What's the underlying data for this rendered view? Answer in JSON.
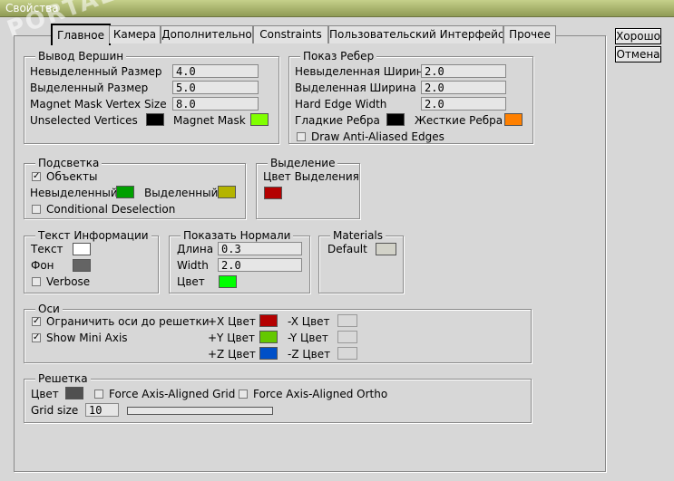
{
  "window": {
    "title": "Свойства"
  },
  "buttons": {
    "ok": "Хорошо",
    "cancel": "Отмена"
  },
  "tabs": [
    {
      "label": "Главное",
      "active": true
    },
    {
      "label": "Камера"
    },
    {
      "label": "Дополнительно"
    },
    {
      "label": "Constraints"
    },
    {
      "label": "Пользовательский Интерфейс"
    },
    {
      "label": "Прочее"
    }
  ],
  "vertex_output": {
    "title": "Вывод Вершин",
    "unselected_size_label": "Невыделенный Размер",
    "unselected_size": "4.0",
    "selected_size_label": "Выделенный Размер",
    "selected_size": "5.0",
    "magnet_mask_size_label": "Magnet Mask Vertex Size",
    "magnet_mask_size": "8.0",
    "unselected_vertices_label": "Unselected Vertices",
    "unselected_vertices_color": "#000000",
    "magnet_mask_label": "Magnet Mask",
    "magnet_mask_color": "#80ff00"
  },
  "edge_display": {
    "title": "Показ Ребер",
    "unselected_width_label": "Невыделенная Ширина",
    "unselected_width": "2.0",
    "selected_width_label": "Выделенная Ширина",
    "selected_width": "2.0",
    "hard_edge_width_label": "Hard Edge Width",
    "hard_edge_width": "2.0",
    "smooth_edges_label": "Гладкие Ребра",
    "smooth_edges_color": "#000000",
    "hard_edges_label": "Жесткие Ребра",
    "hard_edges_color": "#ff8000",
    "antialias_label": "Draw Anti-Aliased Edges",
    "antialias_checked": false
  },
  "highlight": {
    "title": "Подсветка",
    "objects_label": "Объекты",
    "objects_checked": true,
    "unselected_label": "Невыделенный",
    "unselected_color": "#00a000",
    "selected_label": "Выделенный",
    "selected_color": "#b4b400",
    "conditional_label": "Conditional Deselection",
    "conditional_checked": false
  },
  "selection": {
    "title": "Выделение",
    "color_label": "Цвет Выделения",
    "color": "#b40000"
  },
  "info_text": {
    "title": "Текст Информации",
    "text_label": "Текст",
    "text_color": "#ffffff",
    "bg_label": "Фон",
    "bg_color": "#646464",
    "verbose_label": "Verbose",
    "verbose_checked": false
  },
  "normals": {
    "title": "Показать Нормали",
    "length_label": "Длина",
    "length": "0.3",
    "width_label": "Width",
    "width": "2.0",
    "color_label": "Цвет",
    "color": "#00ff00"
  },
  "materials": {
    "title": "Materials",
    "default_label": "Default",
    "default_color": "#d2d2c8"
  },
  "axes": {
    "title": "Оси",
    "limit_label": "Ограничить оси до решетки",
    "limit_checked": true,
    "mini_label": "Show Mini Axis",
    "mini_checked": true,
    "px_label": "+X Цвет",
    "px_color": "#b40000",
    "py_label": "+Y Цвет",
    "py_color": "#64c800",
    "pz_label": "+Z Цвет",
    "pz_color": "#0050c8",
    "nx_label": "-X Цвет",
    "nx_color": "#d8d8d8",
    "ny_label": "-Y Цвет",
    "ny_color": "#d8d8d8",
    "nz_label": "-Z Цвет",
    "nz_color": "#d8d8d8"
  },
  "grid": {
    "title": "Решетка",
    "color_label": "Цвет",
    "color": "#505050",
    "force_grid_label": "Force Axis-Aligned Grid",
    "force_grid_checked": false,
    "force_ortho_label": "Force Axis-Aligned Ortho",
    "force_ortho_checked": false,
    "size_label": "Grid size",
    "size": "10",
    "slider_value": 0.0
  },
  "watermark": "PORTAL"
}
